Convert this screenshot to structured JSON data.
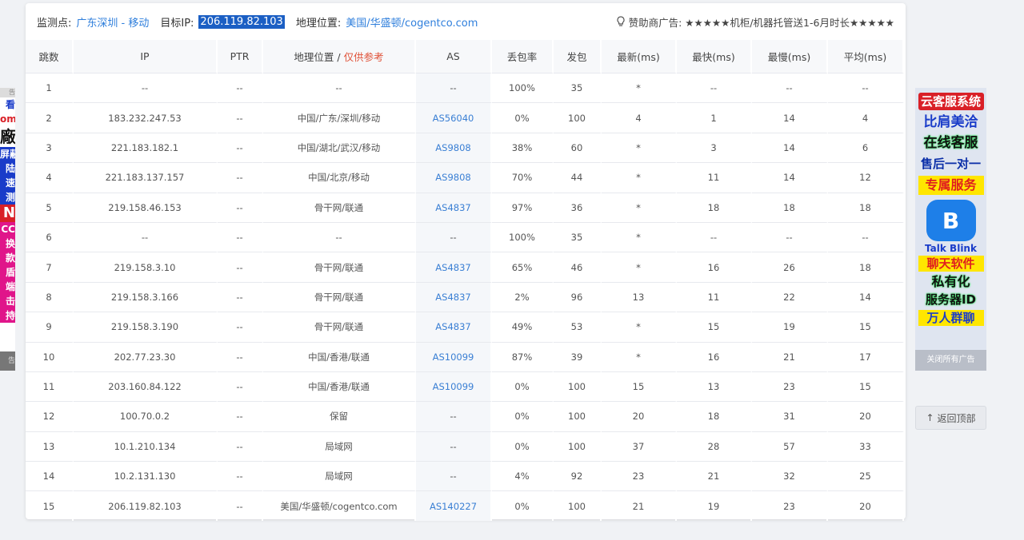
{
  "info": {
    "monitor_label": "监测点:",
    "monitor_value": "广东深圳 - 移动",
    "target_label": "目标IP:",
    "target_value": "206.119.82.103",
    "geo_label": "地理位置:",
    "geo_value": "美国/华盛顿/cogentco.com",
    "sponsor_label": "赞助商广告:",
    "sponsor_value": "★★★★★机柜/机器托管送1-6月时长★★★★★"
  },
  "table": {
    "headers": {
      "hop": "跳数",
      "ip": "IP",
      "ptr": "PTR",
      "geo": "地理位置 / ",
      "geo_ref": "仅供参考",
      "as": "AS",
      "loss": "丢包率",
      "sent": "发包",
      "last": "最新(ms)",
      "best": "最快(ms)",
      "worst": "最慢(ms)",
      "avg": "平均(ms)"
    },
    "rows": [
      {
        "hop": "1",
        "ip": "--",
        "ptr": "--",
        "geo": "--",
        "as": "--",
        "loss": "100%",
        "sent": "35",
        "last": "*",
        "best": "--",
        "worst": "--",
        "avg": "--"
      },
      {
        "hop": "2",
        "ip": "183.232.247.53",
        "ptr": "--",
        "geo": "中国/广东/深圳/移动",
        "as": "AS56040",
        "loss": "0%",
        "sent": "100",
        "last": "4",
        "best": "1",
        "worst": "14",
        "avg": "4"
      },
      {
        "hop": "3",
        "ip": "221.183.182.1",
        "ptr": "--",
        "geo": "中国/湖北/武汉/移动",
        "as": "AS9808",
        "loss": "38%",
        "sent": "60",
        "last": "*",
        "best": "3",
        "worst": "14",
        "avg": "6"
      },
      {
        "hop": "4",
        "ip": "221.183.137.157",
        "ptr": "--",
        "geo": "中国/北京/移动",
        "as": "AS9808",
        "loss": "70%",
        "sent": "44",
        "last": "*",
        "best": "11",
        "worst": "14",
        "avg": "12"
      },
      {
        "hop": "5",
        "ip": "219.158.46.153",
        "ptr": "--",
        "geo": "骨干网/联通",
        "as": "AS4837",
        "loss": "97%",
        "sent": "36",
        "last": "*",
        "best": "18",
        "worst": "18",
        "avg": "18"
      },
      {
        "hop": "6",
        "ip": "--",
        "ptr": "--",
        "geo": "--",
        "as": "--",
        "loss": "100%",
        "sent": "35",
        "last": "*",
        "best": "--",
        "worst": "--",
        "avg": "--"
      },
      {
        "hop": "7",
        "ip": "219.158.3.10",
        "ptr": "--",
        "geo": "骨干网/联通",
        "as": "AS4837",
        "loss": "65%",
        "sent": "46",
        "last": "*",
        "best": "16",
        "worst": "26",
        "avg": "18"
      },
      {
        "hop": "8",
        "ip": "219.158.3.166",
        "ptr": "--",
        "geo": "骨干网/联通",
        "as": "AS4837",
        "loss": "2%",
        "sent": "96",
        "last": "13",
        "best": "11",
        "worst": "22",
        "avg": "14"
      },
      {
        "hop": "9",
        "ip": "219.158.3.190",
        "ptr": "--",
        "geo": "骨干网/联通",
        "as": "AS4837",
        "loss": "49%",
        "sent": "53",
        "last": "*",
        "best": "15",
        "worst": "19",
        "avg": "15"
      },
      {
        "hop": "10",
        "ip": "202.77.23.30",
        "ptr": "--",
        "geo": "中国/香港/联通",
        "as": "AS10099",
        "loss": "87%",
        "sent": "39",
        "last": "*",
        "best": "16",
        "worst": "21",
        "avg": "17"
      },
      {
        "hop": "11",
        "ip": "203.160.84.122",
        "ptr": "--",
        "geo": "中国/香港/联通",
        "as": "AS10099",
        "loss": "0%",
        "sent": "100",
        "last": "15",
        "best": "13",
        "worst": "23",
        "avg": "15"
      },
      {
        "hop": "12",
        "ip": "100.70.0.2",
        "ptr": "--",
        "geo": "保留",
        "as": "--",
        "loss": "0%",
        "sent": "100",
        "last": "20",
        "best": "18",
        "worst": "31",
        "avg": "20"
      },
      {
        "hop": "13",
        "ip": "10.1.210.134",
        "ptr": "--",
        "geo": "局域网",
        "as": "--",
        "loss": "0%",
        "sent": "100",
        "last": "37",
        "best": "28",
        "worst": "57",
        "avg": "33"
      },
      {
        "hop": "14",
        "ip": "10.2.131.130",
        "ptr": "--",
        "geo": "局域网",
        "as": "--",
        "loss": "4%",
        "sent": "92",
        "last": "23",
        "best": "21",
        "worst": "32",
        "avg": "25"
      },
      {
        "hop": "15",
        "ip": "206.119.82.103",
        "ptr": "--",
        "geo": "美国/华盛顿/cogentco.com",
        "as": "AS140227",
        "loss": "0%",
        "sent": "100",
        "last": "21",
        "best": "19",
        "worst": "23",
        "avg": "20"
      }
    ]
  },
  "left_ad": {
    "lines": [
      "看",
      "om",
      "廠",
      "屏蔽",
      "陆",
      "速",
      "测",
      "N",
      "CC",
      "换",
      "款",
      "盾",
      "端",
      "击",
      "持"
    ],
    "tag": "告",
    "footer": "告"
  },
  "right_ad": {
    "lines": [
      "云客服系统",
      "比肩美洽",
      "在线客服",
      "售后一对一",
      "专属服务"
    ],
    "brand": "Talk Blink",
    "lines2": [
      "聊天软件",
      "私有化",
      "服务器ID",
      "万人群聊"
    ],
    "close": "关闭所有广告"
  },
  "back_top": {
    "arrow": "↑",
    "label": "返回顶部"
  },
  "colors": {
    "link": "#2f7fdc",
    "selection": "#1b5fc4",
    "reference": "#e0533a"
  }
}
